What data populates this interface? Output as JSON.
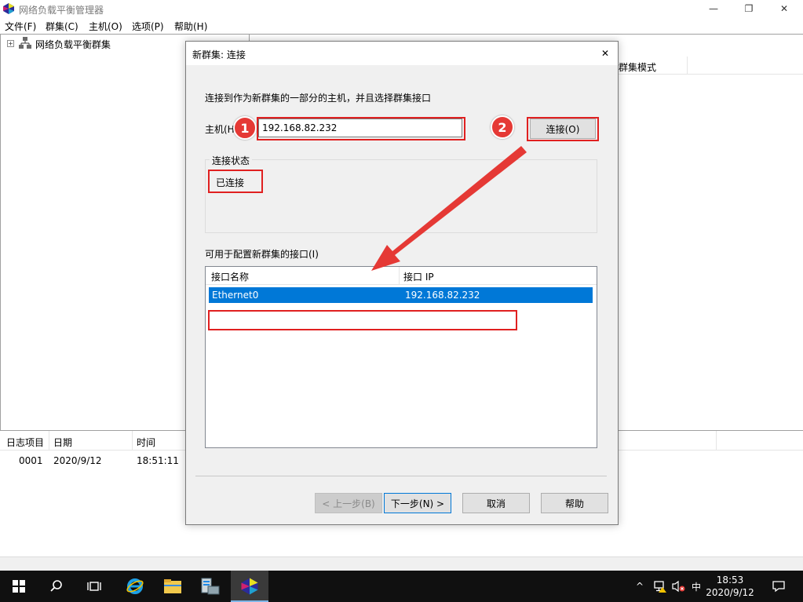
{
  "window": {
    "title": "网络负载平衡管理器",
    "controls": {
      "minimize": "—",
      "maximize": "❐",
      "close": "✕"
    }
  },
  "menu": [
    "文件(F)",
    "群集(C)",
    "主机(O)",
    "选项(P)",
    "帮助(H)"
  ],
  "tree": {
    "expander": "+",
    "root_label": "网络负载平衡群集"
  },
  "right_pane": {
    "column_mode": "群集模式"
  },
  "log": {
    "columns": [
      "日志项目",
      "日期",
      "时间"
    ],
    "rows": [
      {
        "entry": "0001",
        "date": "2020/9/12",
        "time": "18:51:11"
      }
    ]
  },
  "dialog": {
    "title": "新群集: 连接",
    "close": "✕",
    "instruction": "连接到作为新群集的一部分的主机，并且选择群集接口",
    "host_label": "主机(H",
    "host_value": "192.168.82.232",
    "connect_label": "连接(O)",
    "status_group_title": "连接状态",
    "status_value": "已连接",
    "interfaces_label": "可用于配置新群集的接口(I)",
    "interfaces_columns": [
      "接口名称",
      "接口 IP"
    ],
    "interfaces_rows": [
      {
        "name": "Ethernet0",
        "ip": "192.168.82.232"
      }
    ],
    "buttons": {
      "back": "< 上一步(B)",
      "next": "下一步(N) >",
      "cancel": "取消",
      "help": "帮助"
    }
  },
  "annotations": {
    "step1": "1",
    "step2": "2",
    "highlight_color": "#e02020",
    "badge_color": "#e53935"
  },
  "taskbar": {
    "icons": [
      "windows-start-icon",
      "search-icon",
      "task-view-icon",
      "internet-explorer-icon",
      "file-explorer-icon",
      "server-manager-icon",
      "nlb-manager-icon"
    ],
    "tray": {
      "chevron": "^",
      "ime": "中",
      "time": "18:53",
      "date": "2020/9/12"
    }
  },
  "colors": {
    "selection": "#0078d7",
    "taskbar": "#101010"
  }
}
